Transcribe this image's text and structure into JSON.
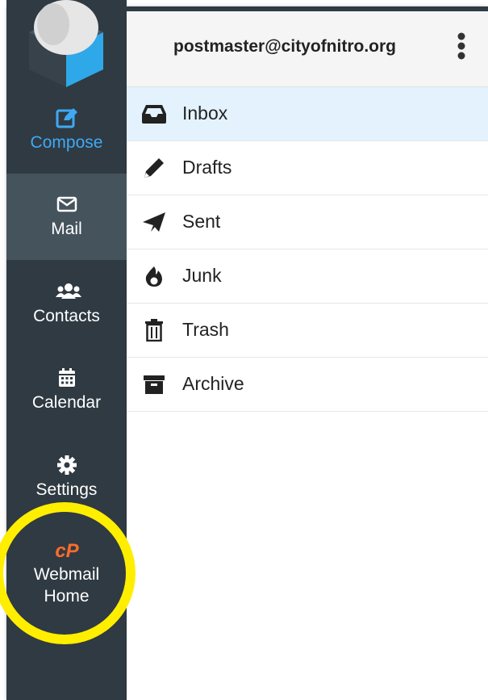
{
  "sidebar": {
    "items": [
      {
        "key": "compose",
        "label": "Compose",
        "icon": "pencil-square-icon"
      },
      {
        "key": "mail",
        "label": "Mail",
        "icon": "envelope-icon"
      },
      {
        "key": "contacts",
        "label": "Contacts",
        "icon": "users-icon"
      },
      {
        "key": "calendar",
        "label": "Calendar",
        "icon": "calendar-icon"
      },
      {
        "key": "settings",
        "label": "Settings",
        "icon": "gear-icon"
      },
      {
        "key": "webmail",
        "label_line1": "Webmail",
        "label_line2": "Home",
        "icon": "cpanel-logo-icon",
        "icon_text": "cP"
      }
    ],
    "active": "mail"
  },
  "header": {
    "account": "postmaster@cityofnitro.org"
  },
  "folders": [
    {
      "label": "Inbox",
      "icon": "inbox-tray-icon",
      "active": true
    },
    {
      "label": "Drafts",
      "icon": "pencil-icon"
    },
    {
      "label": "Sent",
      "icon": "paper-plane-icon"
    },
    {
      "label": "Junk",
      "icon": "fire-icon"
    },
    {
      "label": "Trash",
      "icon": "trash-icon"
    },
    {
      "label": "Archive",
      "icon": "archive-box-icon"
    }
  ],
  "colors": {
    "sidebar_bg": "#2f3a42",
    "sidebar_active_bg": "#45535d",
    "accent": "#3fa9f5",
    "cpanel_orange": "#ff6c2c",
    "highlight": "#ffee00",
    "inbox_active_bg": "#e3f2fd"
  }
}
